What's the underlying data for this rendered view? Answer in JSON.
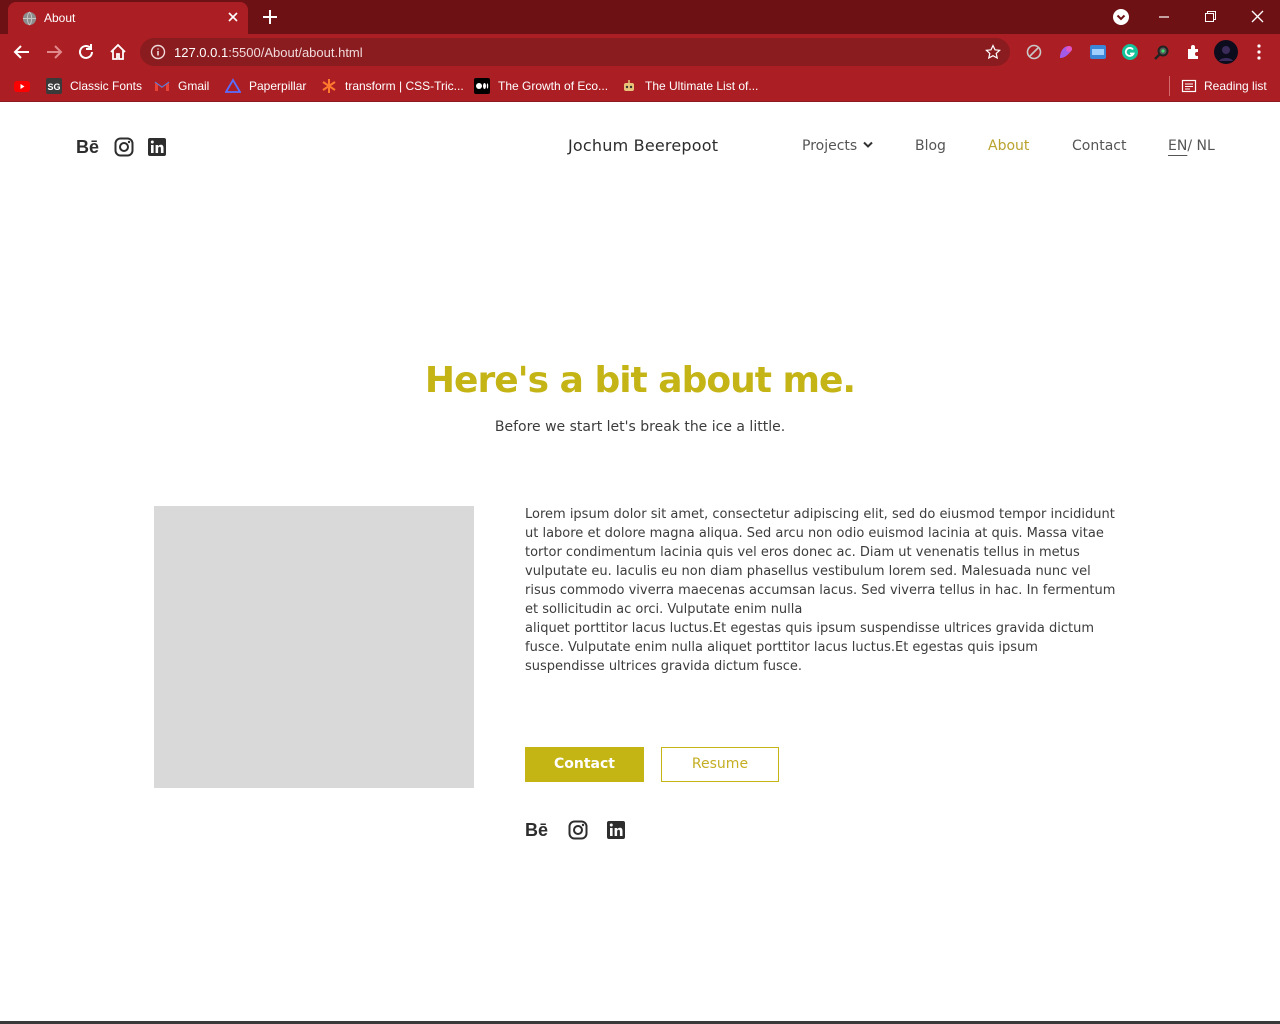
{
  "browser": {
    "tab_title": "About",
    "url_host": "127.0.0.1",
    "url_rest": ":5500/About/about.html",
    "bookmarks": [
      {
        "label": ""
      },
      {
        "label": "Classic Fonts"
      },
      {
        "label": "Gmail"
      },
      {
        "label": "Paperpillar"
      },
      {
        "label": "transform | CSS-Tric..."
      },
      {
        "label": "The Growth of Eco..."
      },
      {
        "label": "The Ultimate List of..."
      }
    ],
    "reading_list": "Reading list",
    "colors": {
      "frame": "#6e1114",
      "toolbar": "#ab1f24"
    }
  },
  "header": {
    "site_name": "Jochum Beerepoot",
    "social": {
      "behance": "Bē"
    },
    "nav": {
      "projects": "Projects",
      "blog": "Blog",
      "about": "About",
      "contact": "Contact",
      "lang_en": "EN",
      "lang_sep": "/",
      "lang_nl": " NL"
    }
  },
  "hero": {
    "title": "Here's a bit about me.",
    "subtitle": "Before we start let's break the ice a little."
  },
  "about": {
    "paragraph_1": "Lorem ipsum dolor sit amet, consectetur adipiscing elit, sed do eiusmod tempor incididunt ut labore et dolore magna aliqua. Sed arcu non odio euismod lacinia at quis. Massa vitae tortor condimentum lacinia quis vel eros donec ac. Diam ut venenatis tellus in metus vulputate eu. Iaculis eu non diam phasellus vestibulum lorem sed. Malesuada nunc vel risus commodo viverra maecenas accumsan lacus. Sed viverra tellus in hac. In fermentum et sollicitudin ac orci. Vulputate enim nulla",
    "paragraph_2": "aliquet porttitor lacus luctus.Et egestas quis ipsum suspendisse ultrices gravida dictum fusce. Vulputate enim nulla aliquet porttitor lacus luctus.Et egestas quis ipsum suspendisse ultrices gravida dictum fusce.",
    "contact_button": "Contact",
    "resume_button": "Resume",
    "social": {
      "behance": "Bē"
    }
  },
  "theme": {
    "accent": "#c4b414",
    "text": "#3c3c3c",
    "photo_placeholder": "#d9d9d9"
  }
}
